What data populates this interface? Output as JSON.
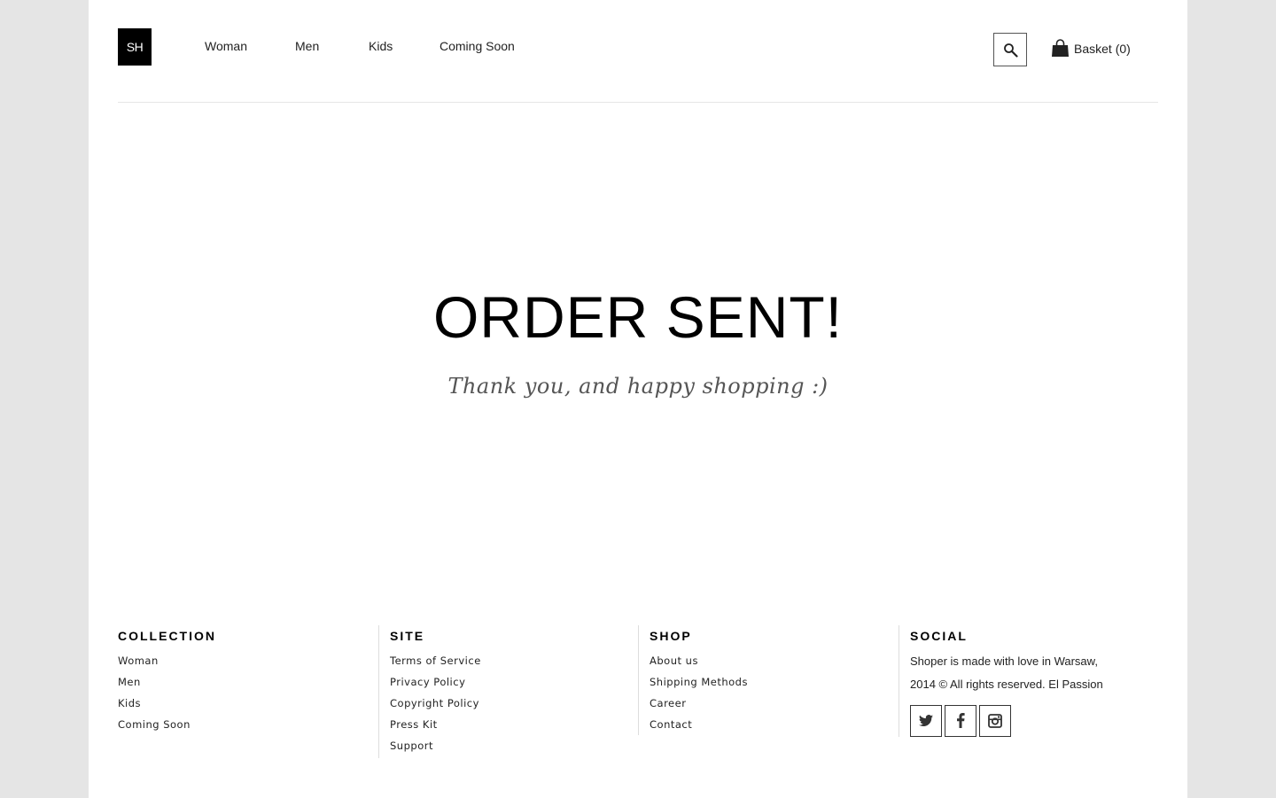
{
  "header": {
    "logo": "SH",
    "nav": [
      "Woman",
      "Men",
      "Kids",
      "Coming Soon"
    ],
    "basket_label": "Basket (0)"
  },
  "main": {
    "headline": "ORDER SENT!",
    "subtitle": "Thank you, and happy shopping :)"
  },
  "footer": {
    "collection": {
      "title": "COLLECTION",
      "items": [
        "Woman",
        "Men",
        "Kids",
        "Coming Soon"
      ]
    },
    "site": {
      "title": "SITE",
      "items": [
        "Terms of Service",
        "Privacy Policy",
        "Copyright Policy",
        "Press Kit",
        "Support"
      ]
    },
    "shop": {
      "title": "SHOP",
      "items": [
        "About us",
        "Shipping Methods",
        "Career",
        "Contact"
      ]
    },
    "social": {
      "title": "SOCIAL",
      "text": "Shoper is made with love in Warsaw, 2014 © All rights reserved. El Passion",
      "icons": [
        "twitter-icon",
        "facebook-icon",
        "instagram-icon"
      ]
    }
  }
}
